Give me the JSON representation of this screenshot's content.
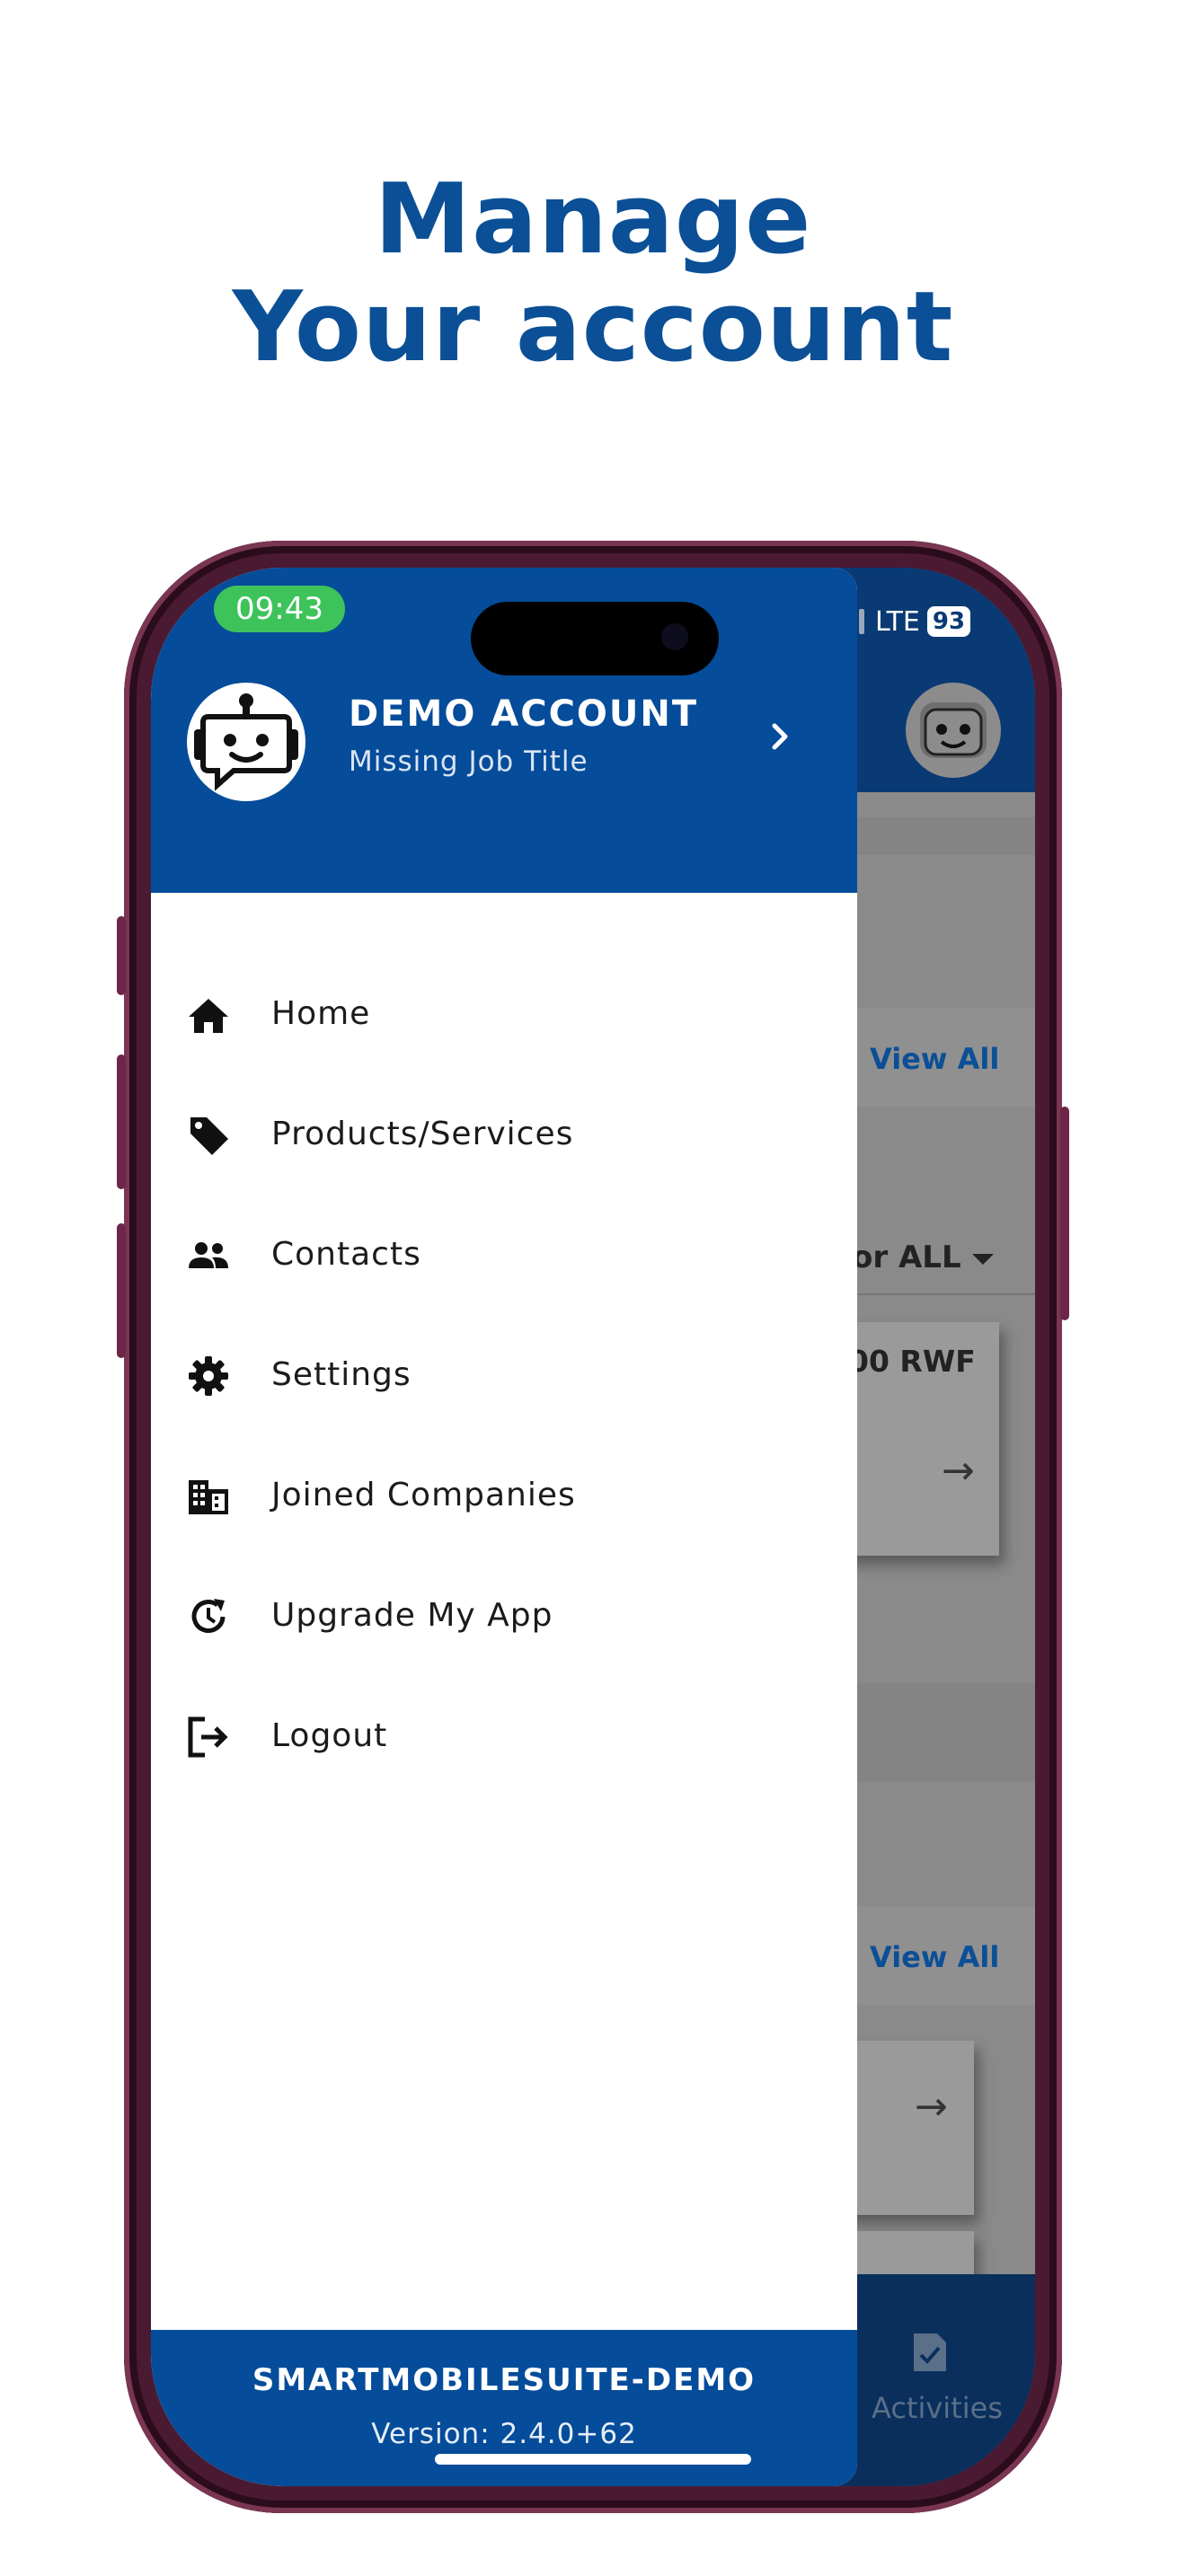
{
  "headline": {
    "line1": "Manage",
    "line2": "Your account"
  },
  "status_bar": {
    "time": "09:43",
    "network": "LTE",
    "battery": "93"
  },
  "drawer": {
    "account_name": "DEMO ACCOUNT",
    "job_title": "Missing Job Title",
    "menu": [
      {
        "label": "Home",
        "icon": "home-icon"
      },
      {
        "label": "Products/Services",
        "icon": "tag-icon"
      },
      {
        "label": "Contacts",
        "icon": "people-icon"
      },
      {
        "label": "Settings",
        "icon": "gear-icon"
      },
      {
        "label": "Joined Companies",
        "icon": "building-icon"
      },
      {
        "label": "Upgrade My App",
        "icon": "update-icon"
      },
      {
        "label": "Logout",
        "icon": "logout-icon"
      }
    ],
    "footer": {
      "app_name": "SMARTMOBILESUITE-DEMO",
      "version": "Version: 2.4.0+62"
    }
  },
  "background_app": {
    "view_all_1": "View All",
    "filter_text": "or ALL",
    "amount_text": "00 RWF",
    "view_all_2": "View All",
    "bottom_tab": "Activities"
  },
  "colors": {
    "brand_blue": "#054c9a",
    "headline_blue": "#0b4f96",
    "time_pill_green": "#3ec35b"
  }
}
